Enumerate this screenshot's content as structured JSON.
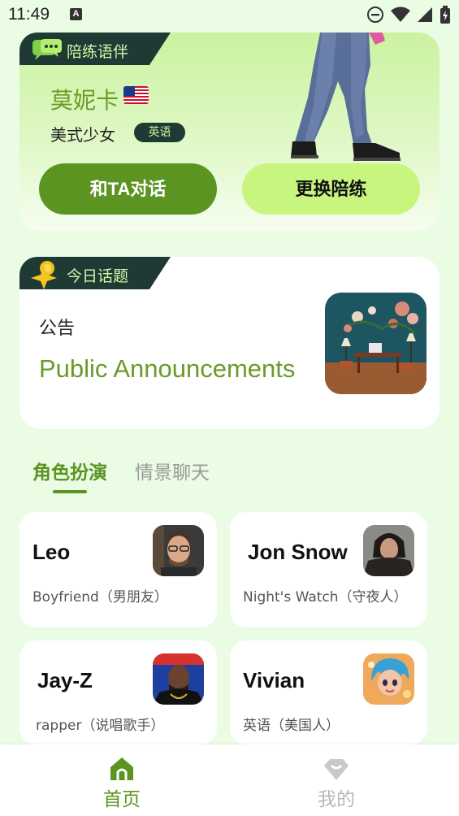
{
  "status_bar": {
    "time": "11:49",
    "notification_letter": "A"
  },
  "companion": {
    "tag": "陪练语伴",
    "name": "莫妮卡",
    "description": "美式少女",
    "language_badge": "英语",
    "chat_button": "和TA对话",
    "switch_button": "更换陪练"
  },
  "topic": {
    "tag": "今日话题",
    "label_cn": "公告",
    "title": "Public Announcements"
  },
  "tabs": [
    {
      "label": "角色扮演",
      "active": true
    },
    {
      "label": "情景聊天",
      "active": false
    }
  ],
  "characters": [
    {
      "name": "Leo",
      "role": "Boyfriend（男朋友）"
    },
    {
      "name": "Jon Snow",
      "role": "Night's Watch（守夜人）"
    },
    {
      "name": "Jay-Z",
      "role": "rapper（说唱歌手）"
    },
    {
      "name": "Vivian",
      "role": "英语（美国人）"
    }
  ],
  "bottom_nav": {
    "home": "首页",
    "mine": "我的"
  },
  "colors": {
    "accent": "#5c9422",
    "accent_light": "#c8f57e",
    "banner_dark": "#1f3a34",
    "background": "#eafce4"
  }
}
